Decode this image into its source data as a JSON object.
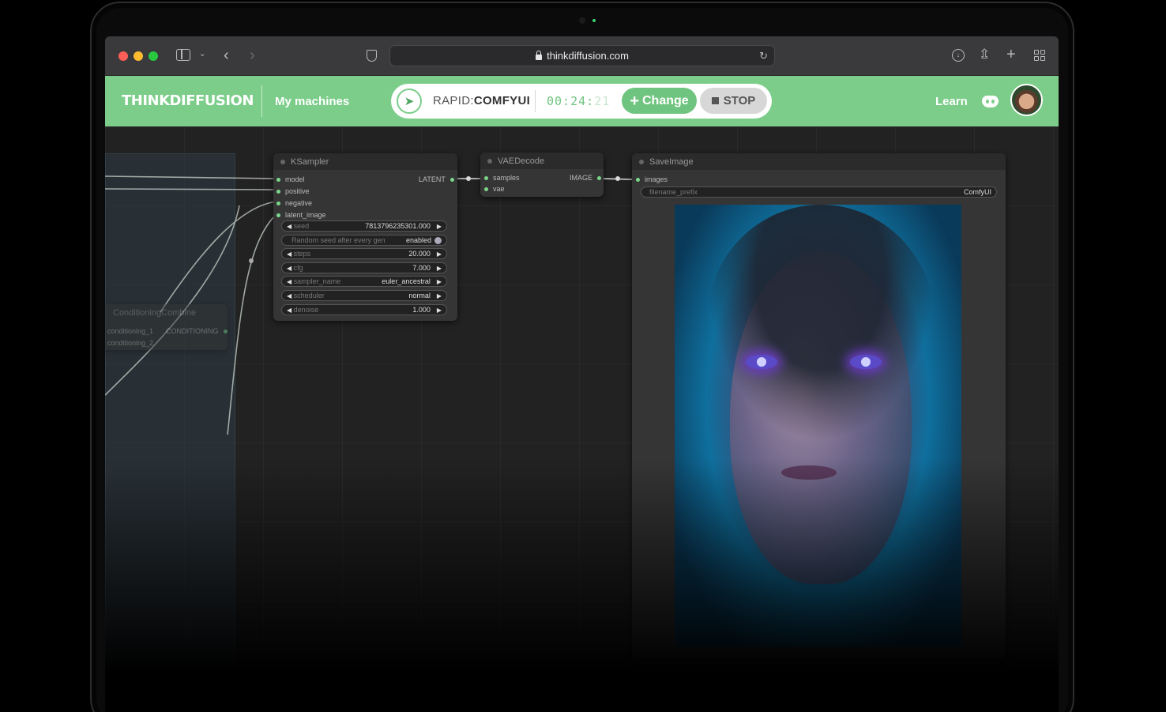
{
  "browser": {
    "url": "thinkdiffusion.com"
  },
  "header": {
    "logo": "THINKDIFFUSION",
    "my_machines": "My machines",
    "machine_type": "RAPID:",
    "machine_app": "COMFYUI",
    "timer_main": "00:24:",
    "timer_seconds": "21",
    "change_label": "Change",
    "stop_label": "STOP",
    "learn_label": "Learn"
  },
  "nodes": {
    "ksampler": {
      "title": "KSampler",
      "inputs": [
        "model",
        "positive",
        "negative",
        "latent_image"
      ],
      "output": "LATENT",
      "widgets": [
        {
          "name": "seed",
          "value": "7813796235301.000"
        },
        {
          "name": "Random seed after every gen",
          "value": "enabled"
        },
        {
          "name": "steps",
          "value": "20.000"
        },
        {
          "name": "cfg",
          "value": "7.000"
        },
        {
          "name": "sampler_name",
          "value": "euler_ancestral"
        },
        {
          "name": "scheduler",
          "value": "normal"
        },
        {
          "name": "denoise",
          "value": "1.000"
        }
      ]
    },
    "vaedecode": {
      "title": "VAEDecode",
      "inputs": [
        "samples",
        "vae"
      ],
      "output": "IMAGE"
    },
    "saveimage": {
      "title": "SaveImage",
      "input": "images",
      "filename_label": "filename_prefix",
      "filename_value": "ComfyUI"
    },
    "conditioning": {
      "title": "ConditioningCombine",
      "inputs": [
        "conditioning_1",
        "conditioning_2"
      ],
      "output": "CONDITIONING"
    }
  },
  "colors": {
    "brand_green": "#7ccd8a",
    "slot_green": "#7bd88a"
  }
}
